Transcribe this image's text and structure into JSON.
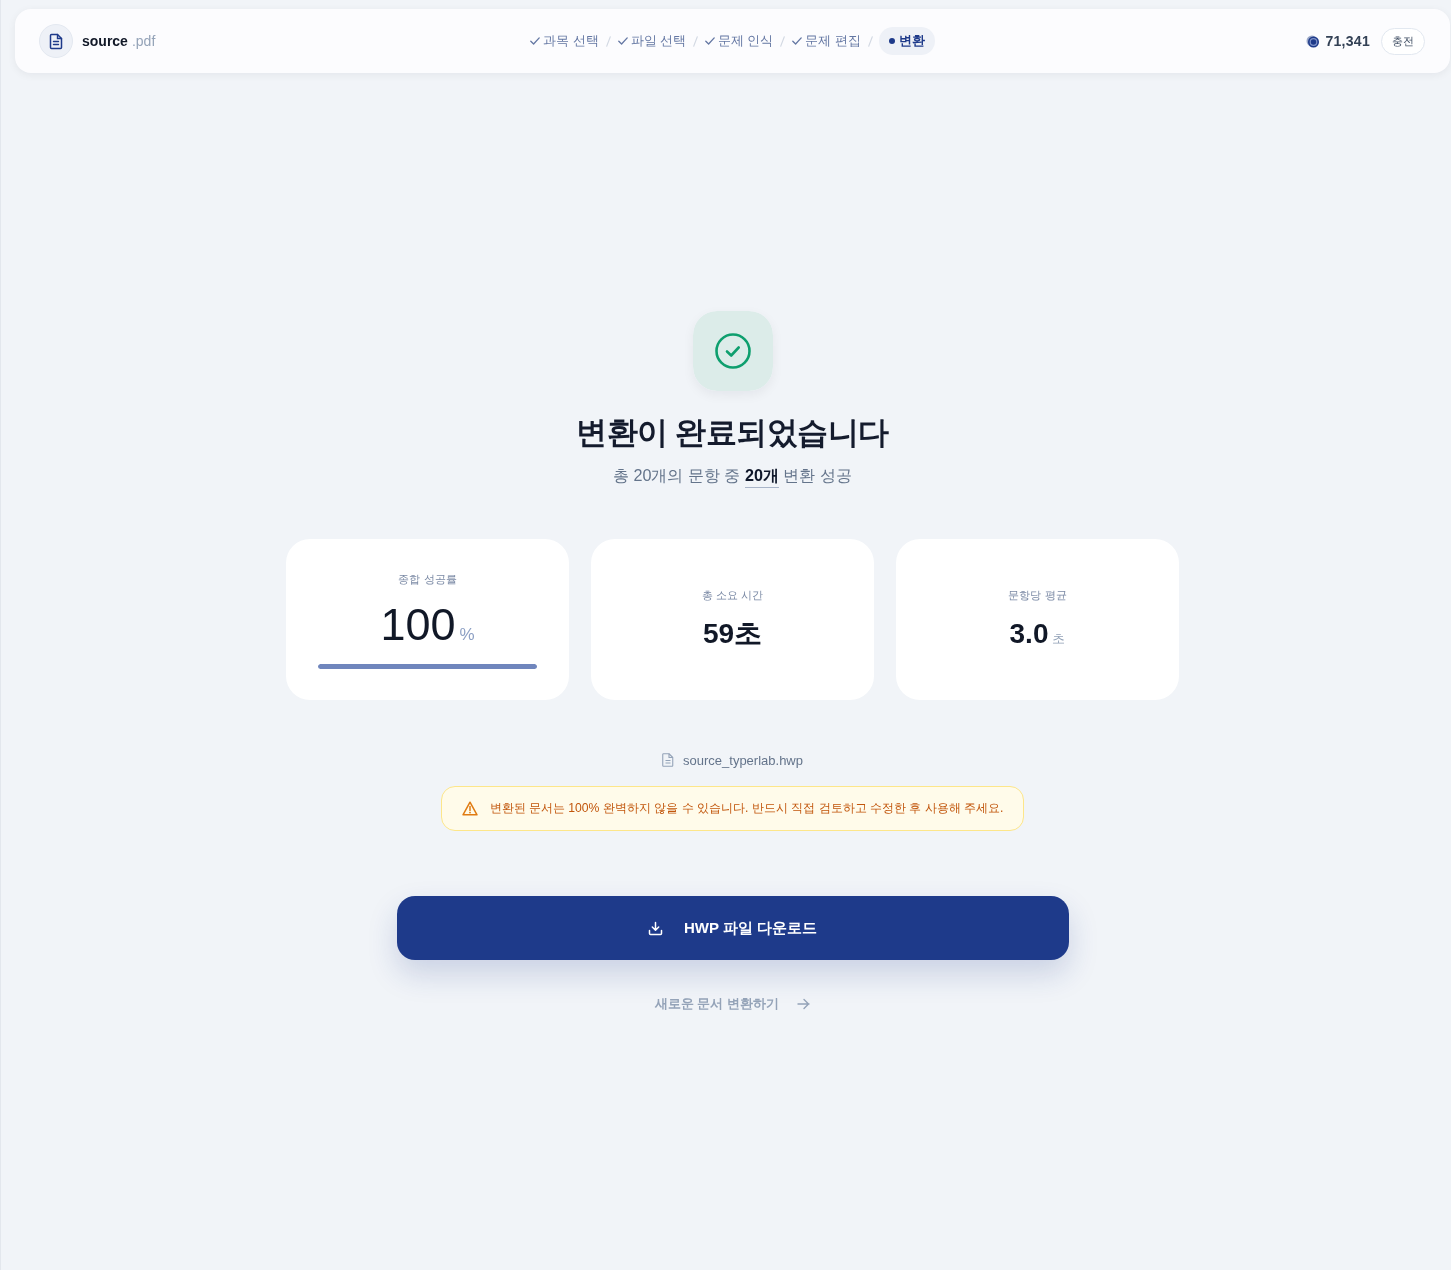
{
  "header": {
    "file": {
      "name": "source",
      "extension": ".pdf"
    },
    "steps": [
      {
        "label": "과목 선택",
        "done": true,
        "selected": false
      },
      {
        "label": "파일 선택",
        "done": true,
        "selected": false
      },
      {
        "label": "문제 인식",
        "done": true,
        "selected": false
      },
      {
        "label": "문제 편집",
        "done": true,
        "selected": false
      },
      {
        "label": "변환",
        "done": false,
        "selected": true
      }
    ],
    "credits": "71,341",
    "charge_button": "충전"
  },
  "result": {
    "title": "변환이 완료되었습니다",
    "summary": "총 20개의 문항 중 **20개** 변환 성공"
  },
  "stats": [
    {
      "kind": "meter",
      "label": "종합 성공률",
      "value": "100",
      "unit": "%",
      "level": 1
    },
    {
      "kind": "figure",
      "label": "총 소요 시간",
      "value": "59초"
    },
    {
      "kind": "figure",
      "label": "문항당 평균",
      "value": "3.0",
      "unit": "초"
    }
  ],
  "output_file": "source_typerlab.hwp",
  "warning": "변환된 문서는 100% 완벽하지 않을 수 있습니다. 반드시 직접 검토하고 수정한 후 사용해 주세요.",
  "download_button": "HWP 파일 다운로드",
  "new_document_link": "새로운 문서 변환하기"
}
